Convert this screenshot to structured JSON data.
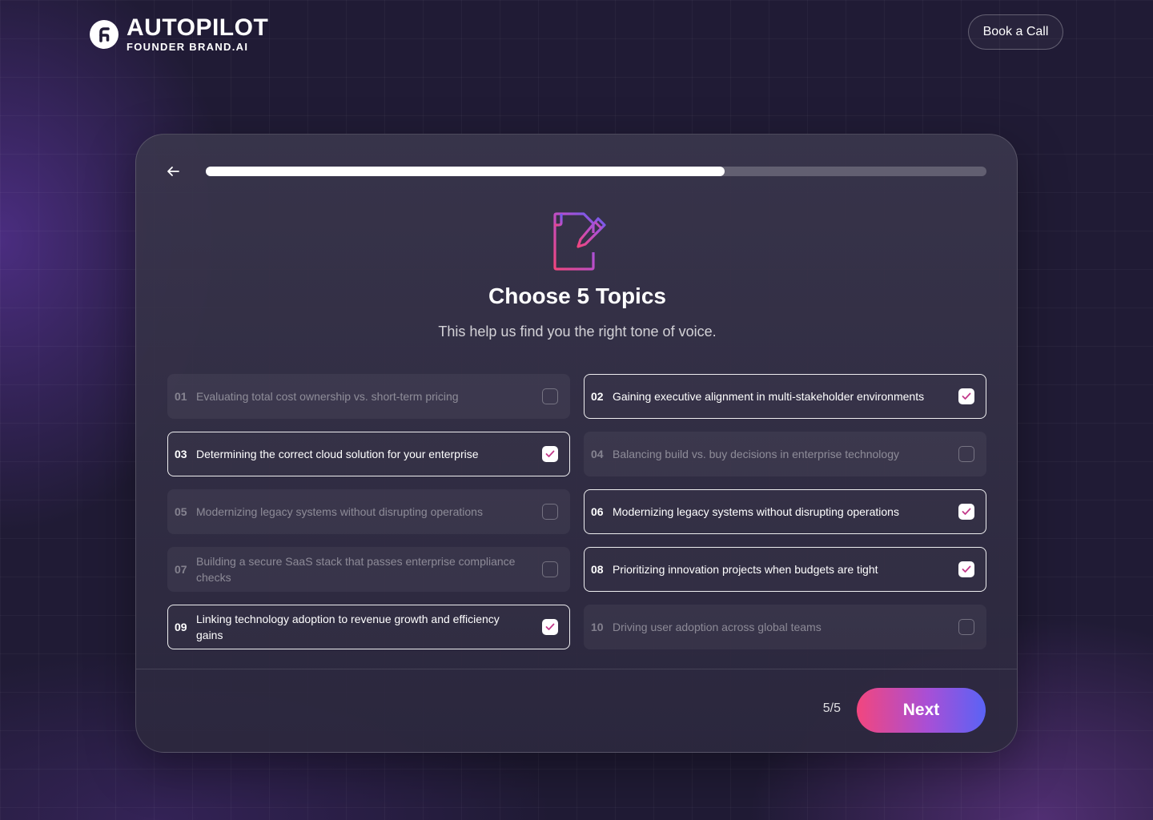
{
  "header": {
    "logo_title": "AUTOPILOT",
    "logo_subtitle": "FOUNDER BRAND.AI",
    "book_call_label": "Book a Call"
  },
  "progress": {
    "fraction": 0.665
  },
  "card": {
    "title": "Choose 5 Topics",
    "subtitle": "This help us find you the right tone of voice."
  },
  "topics": [
    {
      "num": "01",
      "label": "Evaluating total cost ownership vs. short-term pricing",
      "selected": false
    },
    {
      "num": "02",
      "label": "Gaining executive alignment in multi-stakeholder environments",
      "selected": true
    },
    {
      "num": "03",
      "label": "Determining the correct cloud solution for your enterprise",
      "selected": true
    },
    {
      "num": "04",
      "label": "Balancing build vs. buy decisions in enterprise technology",
      "selected": false
    },
    {
      "num": "05",
      "label": "Modernizing legacy systems without disrupting operations",
      "selected": false
    },
    {
      "num": "06",
      "label": "Modernizing legacy systems without disrupting operations",
      "selected": true
    },
    {
      "num": "07",
      "label": "Building a secure SaaS stack that passes enterprise compliance checks",
      "selected": false
    },
    {
      "num": "08",
      "label": "Prioritizing innovation projects when budgets are tight",
      "selected": true
    },
    {
      "num": "09",
      "label": "Linking technology adoption to revenue growth and efficiency gains",
      "selected": true
    },
    {
      "num": "10",
      "label": "Driving user adoption across global teams",
      "selected": false
    }
  ],
  "footer": {
    "counter": "5/5",
    "next_label": "Next"
  },
  "colors": {
    "background": "#201b35",
    "accent_start": "#f2467e",
    "accent_end": "#5a63f5",
    "check_color": "#c23a8a"
  },
  "icons": {
    "logo": "founderbrand-logo-icon",
    "back": "arrow-left-icon",
    "topic_header": "document-pencil-icon",
    "check": "check-icon"
  }
}
